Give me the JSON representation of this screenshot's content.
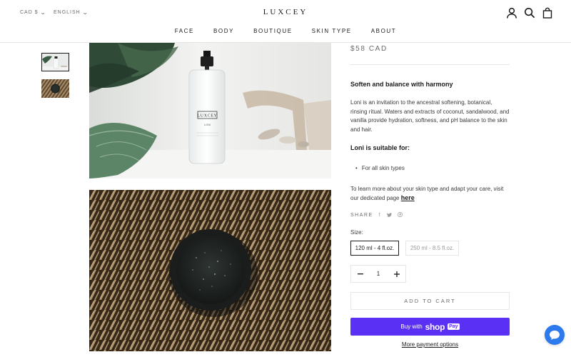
{
  "header": {
    "currency": "CAD $",
    "language": "ENGLISH",
    "logo": "LUXCEY",
    "nav": [
      "FACE",
      "BODY",
      "BOUTIQUE",
      "SKIN TYPE",
      "ABOUT"
    ],
    "icons": [
      "account-icon",
      "search-icon",
      "cart-icon"
    ]
  },
  "product": {
    "price": "$58 CAD",
    "bottle_label_brand": "LUXCEY",
    "bottle_label_name": "LONI",
    "heading": "Soften and balance with harmony",
    "description": "Loni is an invitation to the ancestral softening, botanical, rinsing ritual. Waters and extracts of coconut, sandalwood, and vanilla provide hydration, softness, and pH balance to the skin and hair.",
    "suitable_heading": "Loni is suitable for:",
    "suitable_items": [
      "For all skin types"
    ],
    "learn_text": "To learn more about your skin type and adapt your care, visit our dedicated page",
    "learn_link": "here",
    "share_label": "SHARE",
    "share_icons": [
      "facebook-icon",
      "twitter-icon",
      "pinterest-icon"
    ],
    "size_label": "Size:",
    "sizes": [
      "120 ml - 4 fl.oz.",
      "250 ml - 8.5 fl.oz."
    ],
    "selected_size": "120 ml - 4 fl.oz.",
    "quantity": "1",
    "add_to_cart": "ADD TO CART",
    "buy_with": "Buy with",
    "shop_brand": "shop",
    "shop_pay": "Pay",
    "more_payment": "More payment options"
  },
  "colors": {
    "shop_pay": "#5a31f4",
    "chat": "#2d79ee",
    "text": "#1c1b1b",
    "muted": "#6a6a6a"
  }
}
